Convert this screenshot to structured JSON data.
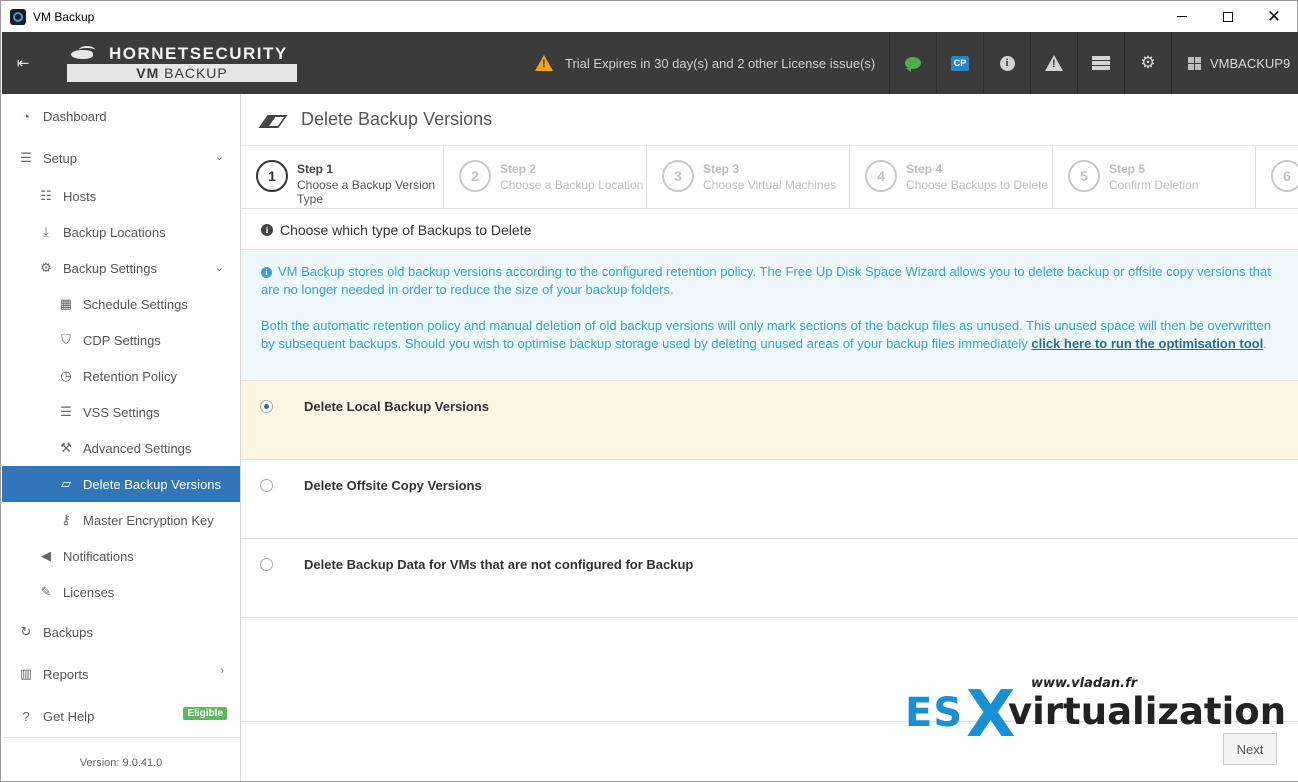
{
  "window": {
    "title": "VM Backup"
  },
  "header": {
    "brand": "HORNETSECURITY",
    "product_prefix": "VM",
    "product_suffix": "BACKUP",
    "trial_text": "Trial Expires in 30 day(s) and 2 other License issue(s)",
    "cp_label": "CP",
    "user": "VMBACKUP9"
  },
  "sidebar": {
    "items": [
      {
        "label": "Dashboard",
        "icon": "dashboard-icon"
      },
      {
        "label": "Setup",
        "icon": "sliders-icon"
      },
      {
        "label": "Hosts",
        "icon": "list-icon"
      },
      {
        "label": "Backup Locations",
        "icon": "download-icon"
      },
      {
        "label": "Backup Settings",
        "icon": "cogs-icon"
      },
      {
        "label": "Schedule Settings",
        "icon": "calendar-icon"
      },
      {
        "label": "CDP Settings",
        "icon": "shield-icon"
      },
      {
        "label": "Retention Policy",
        "icon": "clock-icon"
      },
      {
        "label": "VSS Settings",
        "icon": "list-icon"
      },
      {
        "label": "Advanced Settings",
        "icon": "wrench-icon"
      },
      {
        "label": "Delete Backup Versions",
        "icon": "eraser-icon"
      },
      {
        "label": "Master Encryption Key",
        "icon": "key-icon"
      },
      {
        "label": "Notifications",
        "icon": "bullhorn-icon"
      },
      {
        "label": "Licenses",
        "icon": "edit-icon"
      },
      {
        "label": "Backups",
        "icon": "refresh-icon"
      },
      {
        "label": "Reports",
        "icon": "bar-chart-icon"
      },
      {
        "label": "Get Help",
        "icon": "question-icon"
      }
    ],
    "get_help_badge": "Eligible",
    "version": "Version: 9.0.41.0"
  },
  "page": {
    "title": "Delete Backup Versions",
    "steps": [
      {
        "num": "1",
        "title": "Step 1",
        "desc": "Choose a Backup Version Type"
      },
      {
        "num": "2",
        "title": "Step 2",
        "desc": "Choose a Backup Location"
      },
      {
        "num": "3",
        "title": "Step 3",
        "desc": "Choose Virtual Machines"
      },
      {
        "num": "4",
        "title": "Step 4",
        "desc": "Choose Backups to Delete"
      },
      {
        "num": "5",
        "title": "Step 5",
        "desc": "Confirm Deletion"
      },
      {
        "num": "6",
        "title": "",
        "desc": ""
      }
    ],
    "section_title": "Choose which type of Backups to Delete",
    "info_para1": "VM Backup stores old backup versions according to the configured retention policy. The Free Up Disk Space Wizard allows you to delete backup or offsite copy versions that are no longer needed in order to reduce the size of your backup folders.",
    "info_para2": "Both the automatic retention policy and manual deletion of old backup versions will only mark sections of the backup files as unused. This unused space will then be overwritten by subsequent backups. Should you wish to optimise backup storage used by deleting unused areas of your backup files immediately ",
    "info_link": "click here to run the optimisation tool",
    "info_end": ".",
    "options": [
      {
        "label": "Delete Local Backup Versions",
        "selected": true
      },
      {
        "label": "Delete Offsite Copy Versions",
        "selected": false
      },
      {
        "label": "Delete Backup Data for VMs that are not configured for Backup",
        "selected": false
      }
    ],
    "next_label": "Next"
  },
  "watermark": {
    "url": "www.vladan.fr",
    "es": "ES",
    "x": "X",
    "virt": "virtualization"
  },
  "colors": {
    "header_bg": "#3b3b3b",
    "accent": "#3276b8",
    "info_text": "#3aa0d1",
    "selected_row": "#fcf5e3",
    "eligible": "#5cb85c"
  }
}
